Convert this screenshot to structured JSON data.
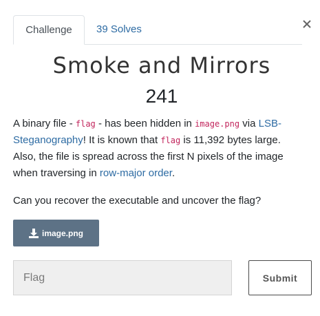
{
  "tabs": [
    {
      "label": "Challenge",
      "active": true
    },
    {
      "label": "39 Solves",
      "active": false
    }
  ],
  "challenge": {
    "name": "Smoke and Mirrors",
    "value": "241"
  },
  "description": {
    "t1": "A binary file - ",
    "code1": "flag",
    "t2": " - has been hidden in ",
    "code2": "image.png",
    "t3": " via ",
    "link1": "LSB-Steganography",
    "t4": "! It is known that ",
    "code3": "flag",
    "t5": " is 11,392 bytes large. Also, the file is spread across the first N pixels of the image when traversing in ",
    "link2": "row-major order",
    "t6": ".",
    "question": "Can you recover the executable and uncover the flag?"
  },
  "download": {
    "label": "image.png",
    "icon": "download-icon"
  },
  "form": {
    "placeholder": "Flag",
    "submit_label": "Submit"
  },
  "colors": {
    "link": "#2d6ba3",
    "code": "#c2255c",
    "download_bg": "#5d7286",
    "input_bg": "#efefef"
  }
}
